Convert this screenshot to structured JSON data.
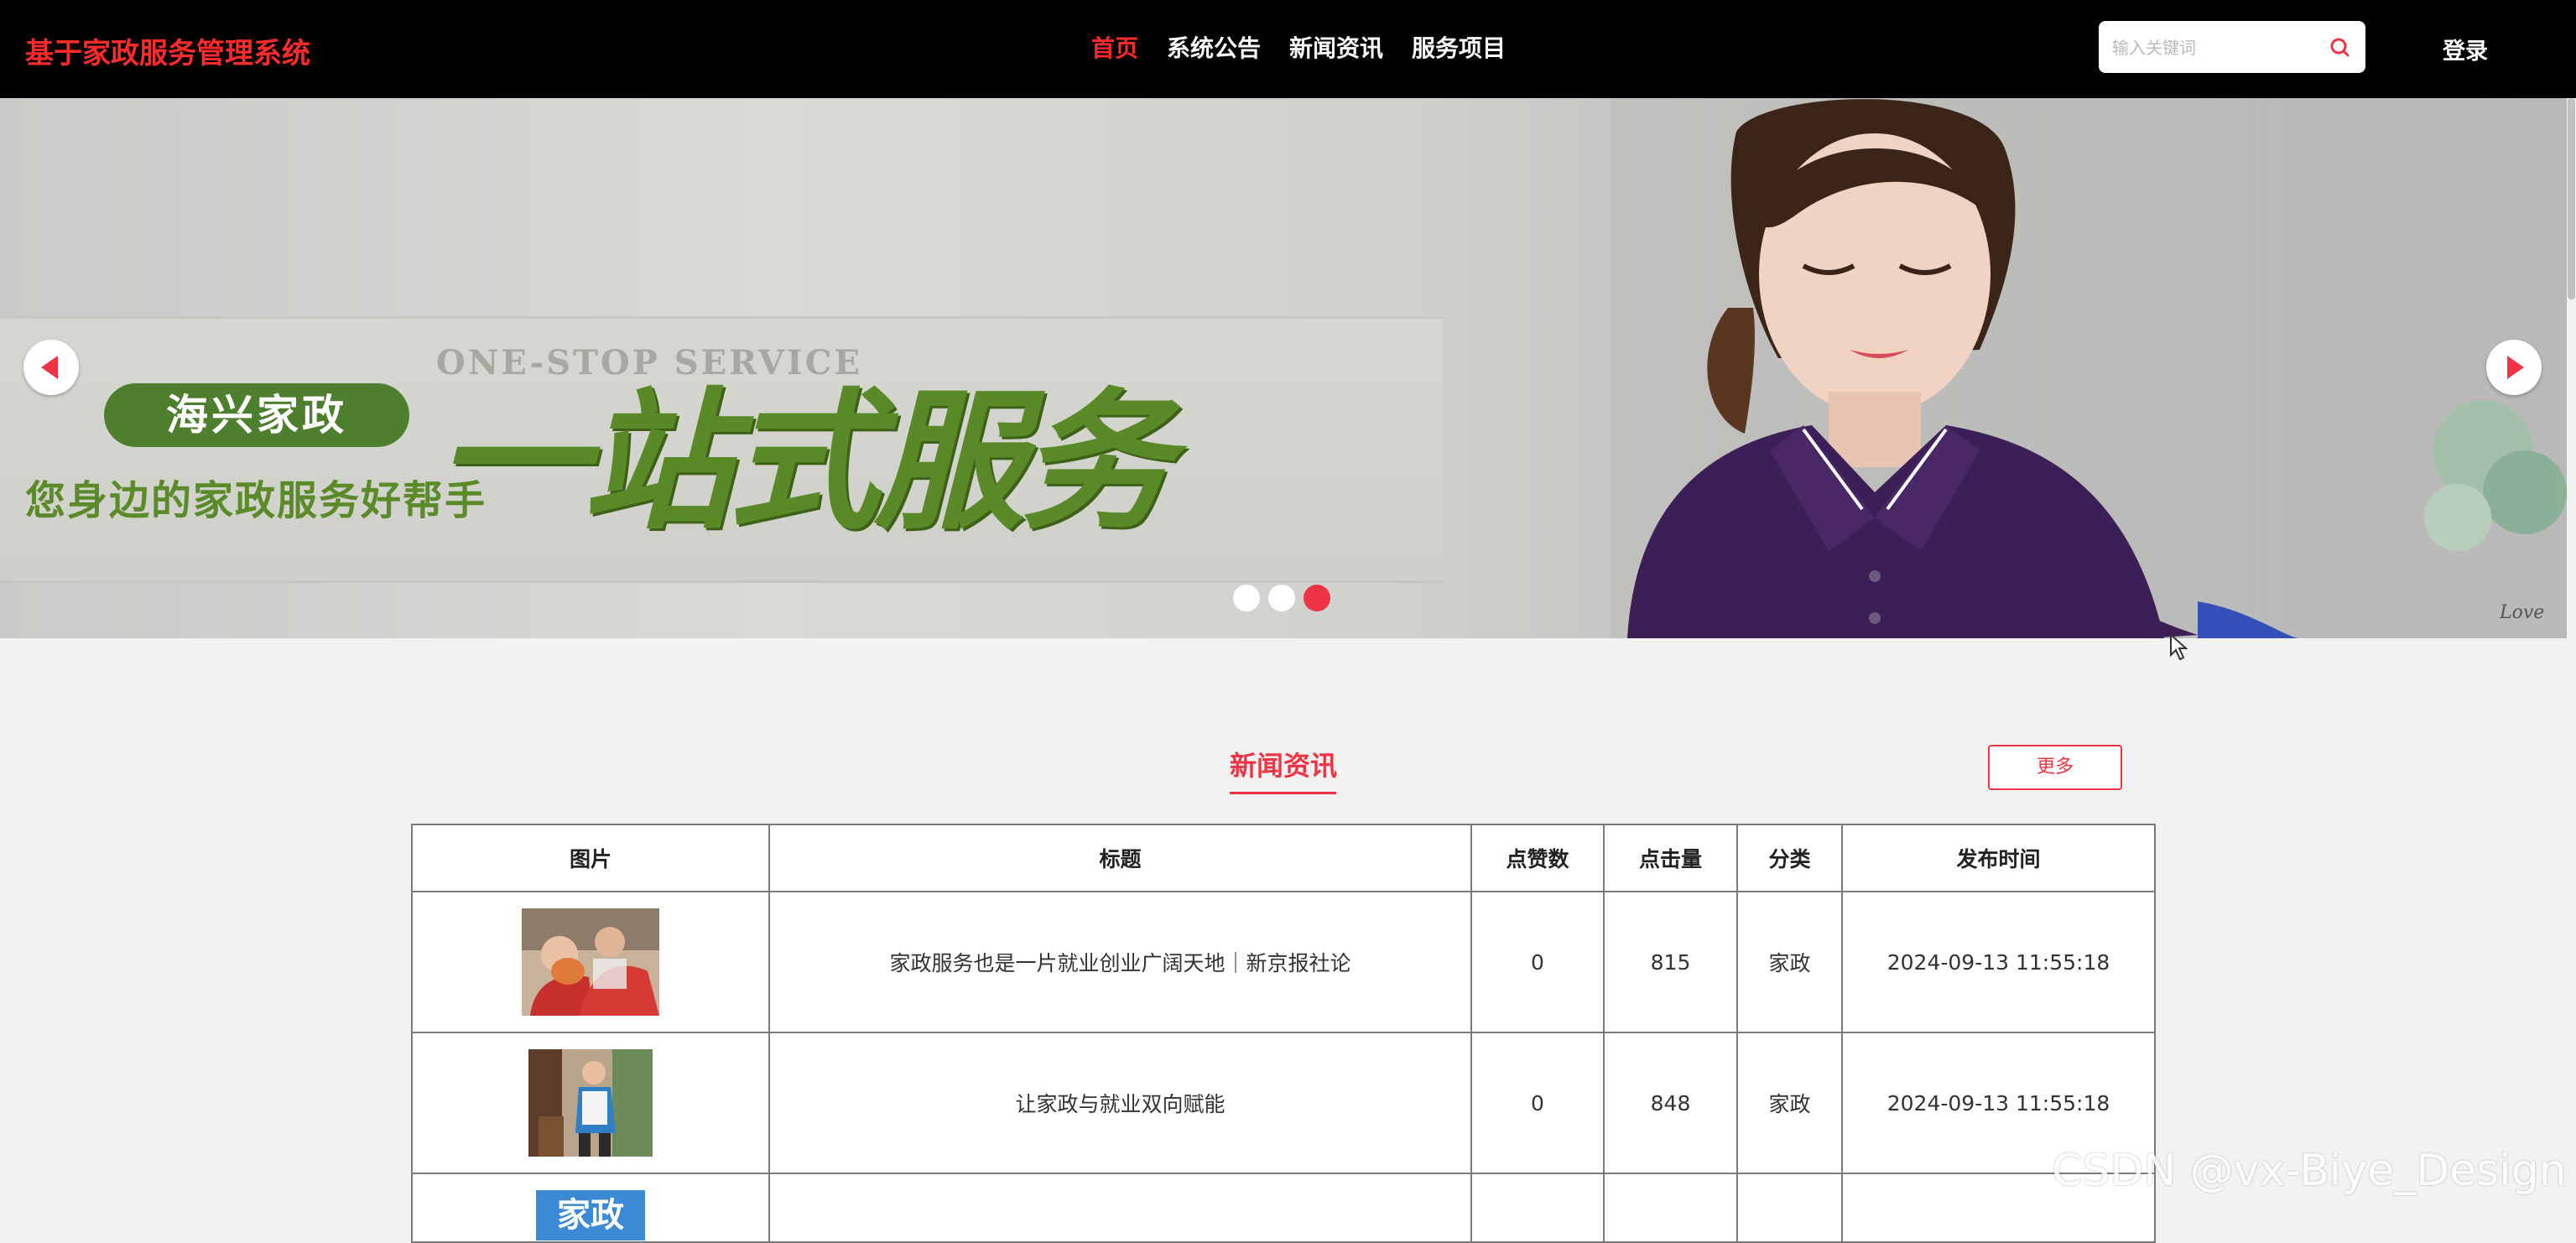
{
  "header": {
    "brand": "基于家政服务管理系统",
    "nav": [
      {
        "label": "首页",
        "active": true
      },
      {
        "label": "系统公告",
        "active": false
      },
      {
        "label": "新闻资讯",
        "active": false
      },
      {
        "label": "服务项目",
        "active": false
      }
    ],
    "search_placeholder": "输入关键词",
    "search_icon": "search-icon",
    "login_label": "登录"
  },
  "banner": {
    "badge_text": "海兴家政",
    "english_text": "ONE-STOP SERVICE",
    "headline": "一站式服务",
    "tagline": "您身边的家政服务好帮手",
    "corner_text": "Love",
    "prev_icon": "chevron-left-icon",
    "next_icon": "chevron-right-icon",
    "dot_count": 3,
    "active_dot": 3
  },
  "news": {
    "title": "新闻资讯",
    "more_label": "更多",
    "columns": [
      "图片",
      "标题",
      "点赞数",
      "点击量",
      "分类",
      "发布时间"
    ],
    "rows": [
      {
        "title": "家政服务也是一片就业创业广阔天地｜新京报社论",
        "likes": "0",
        "views": "815",
        "category": "家政",
        "published": "2024-09-13 11:55:18"
      },
      {
        "title": "让家政与就业双向赋能",
        "likes": "0",
        "views": "848",
        "category": "家政",
        "published": "2024-09-13 11:55:18"
      },
      {
        "title": "",
        "likes": "",
        "views": "",
        "category": "",
        "published": "",
        "thumb_text": "家政"
      }
    ]
  },
  "watermark": "CSDN @vx-Biye_Design",
  "colors": {
    "accent": "#ef3446",
    "brand": "#ff2a2a",
    "header_bg": "#000000",
    "page_bg": "#f2f2f2"
  }
}
